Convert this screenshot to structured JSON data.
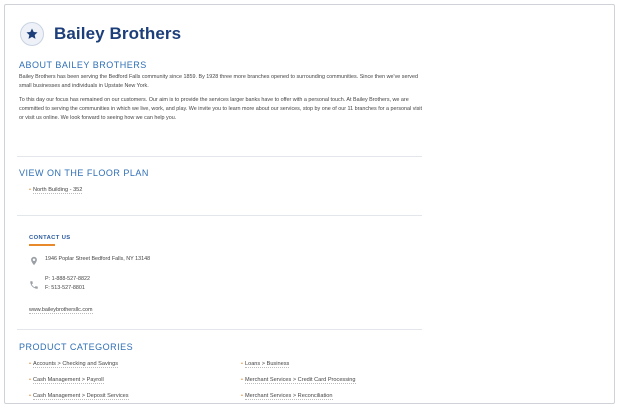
{
  "header": {
    "brand_name": "Bailey Brothers",
    "logo_icon": "star-icon"
  },
  "about": {
    "title": "ABOUT BAILEY BROTHERS",
    "paragraph1": "Bailey Brothers has been serving the Bedford Falls community since 1859. By 1928 three more branches opened to surrounding communities. Since then we've served small businesses and individuals in Upstate New York.",
    "paragraph2": "To this day our focus has remained on our customers. Our aim is to provide the services larger banks have to offer with a personal touch. At Bailey Brothers, we are committed to serving the communities in which we live, work, and play. We invite you to learn more about our services, stop by one of our 11 branches for a personal visit or visit us online. We look forward to seeing how we can help you."
  },
  "floor_plan": {
    "title": "VIEW ON THE FLOOR PLAN",
    "link": "North Building - 352"
  },
  "contact": {
    "title": "CONTACT US",
    "address": "1946 Poplar Street Bedford Falls, NY 13148",
    "phone": "P:  1-888-527-8822",
    "fax": "F:  513-527-8801",
    "website": "www.baileybrothersllc.com"
  },
  "products": {
    "title": "PRODUCT CATEGORIES",
    "left": [
      "Accounts > Checking and Savings",
      "Cash Management > Payroll",
      "Cash Management > Deposit Services"
    ],
    "right": [
      "Loans > Business",
      "Merchant Services > Credit Card Processing",
      "Merchant Services > Reconciliation"
    ]
  },
  "colors": {
    "brand": "#1c3e7a",
    "section_title": "#2f6fb5",
    "accent": "#e88a2c"
  }
}
